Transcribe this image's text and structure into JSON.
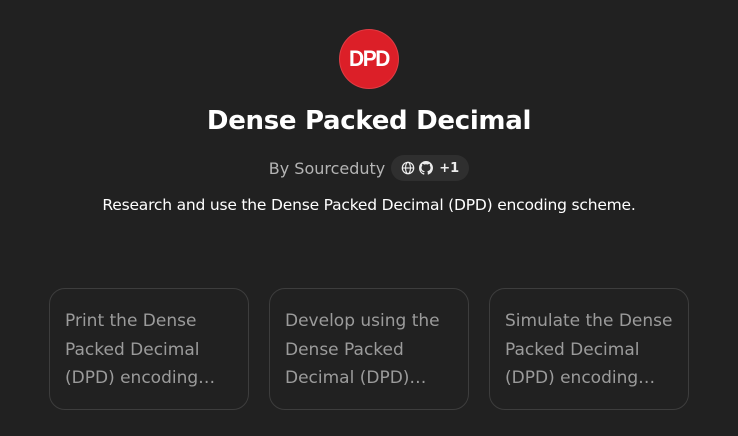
{
  "gpt": {
    "logo_text": "DPD",
    "logo_color": "#dc1f28",
    "title": "Dense Packed Decimal",
    "author": "By Sourceduty",
    "links_count": "+1",
    "description": "Research and use the Dense Packed Decimal (DPD) encoding scheme."
  },
  "icons": {
    "globe": "globe-icon",
    "github": "github-icon"
  },
  "conversation_starters": [
    {
      "text": "Print the Dense Packed Decimal (DPD) encoding…"
    },
    {
      "text": "Develop using the Dense Packed Decimal (DPD)…"
    },
    {
      "text": "Simulate the Dense Packed Decimal (DPD) encoding…"
    }
  ],
  "colors": {
    "background": "#212121",
    "card_border": "#3d3d3d",
    "card_text": "#9b9b9b",
    "pill_background": "#2f2f2f"
  }
}
